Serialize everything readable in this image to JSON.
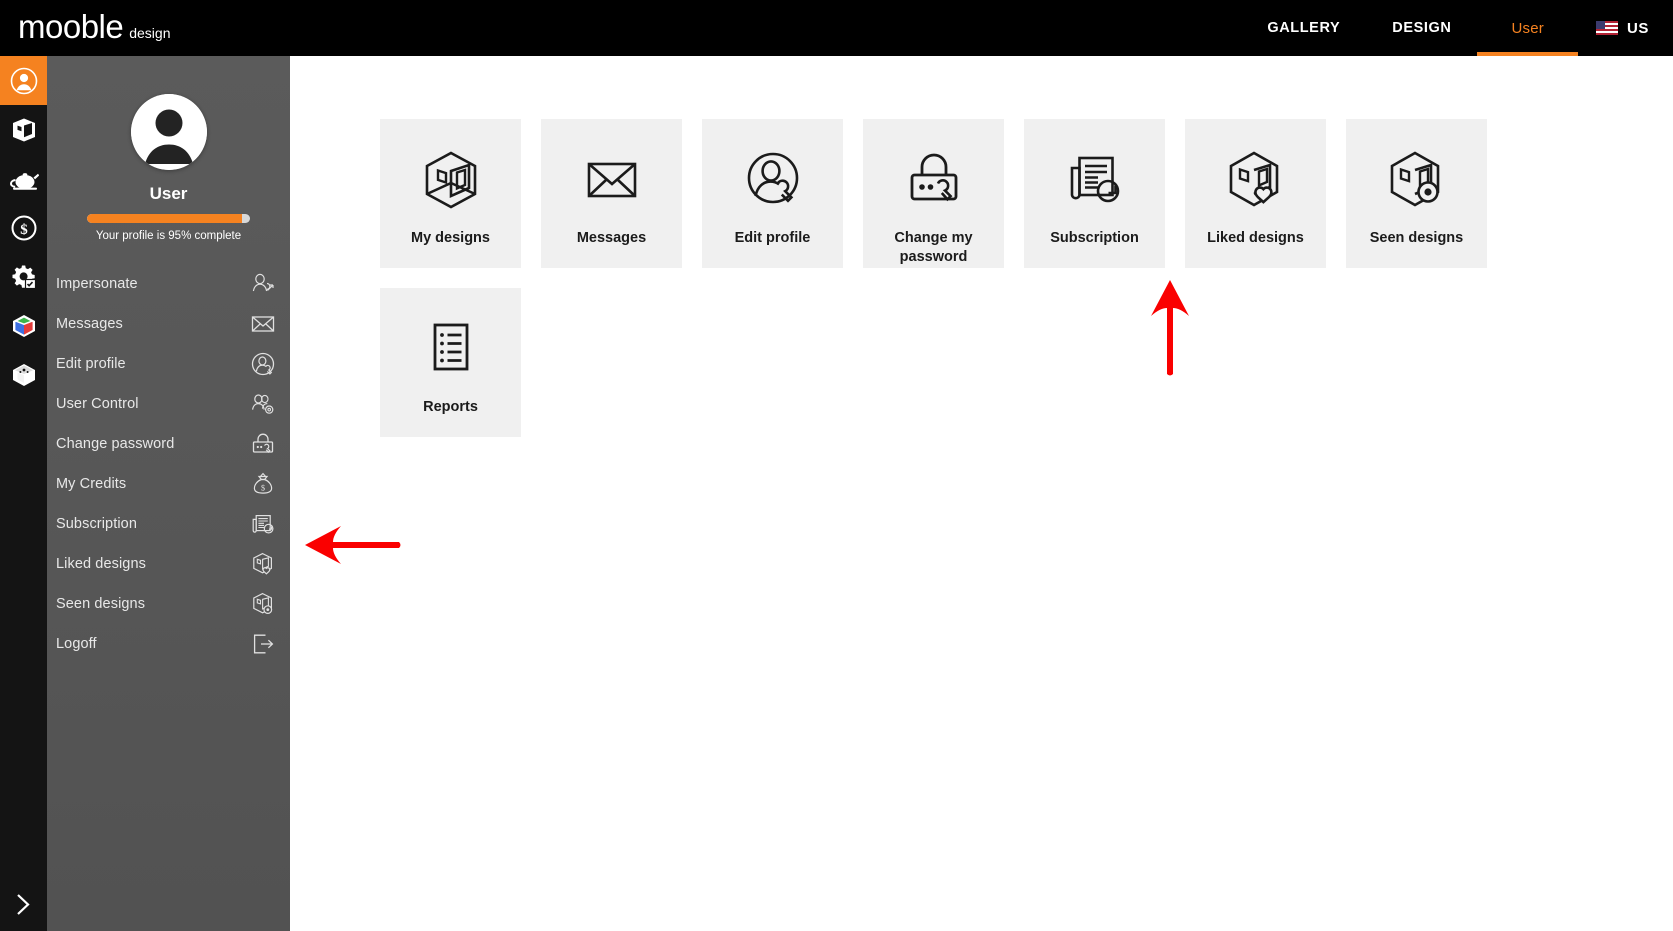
{
  "header": {
    "logo_main": "mooble",
    "logo_sub": "design",
    "nav": [
      {
        "label": "GALLERY",
        "name": "nav-gallery",
        "active": false
      },
      {
        "label": "DESIGN",
        "name": "nav-design",
        "active": false
      },
      {
        "label": "User",
        "name": "nav-user",
        "active": true
      }
    ],
    "language": {
      "label": "US",
      "flag": "us-flag-icon"
    }
  },
  "rail": {
    "items": [
      {
        "icon": "user-circle-icon",
        "name": "rail-item-user",
        "active": true
      },
      {
        "icon": "room-design-icon",
        "name": "rail-item-designs",
        "active": false
      },
      {
        "icon": "teapot-icon",
        "name": "rail-item-products",
        "active": false
      },
      {
        "icon": "dollar-circle-icon",
        "name": "rail-item-credits",
        "active": false
      },
      {
        "icon": "gear-checklist-icon",
        "name": "rail-item-settings",
        "active": false
      },
      {
        "icon": "color-cube-icon",
        "name": "rail-item-materials",
        "active": false
      },
      {
        "icon": "white-cube-icon",
        "name": "rail-item-models",
        "active": false
      }
    ],
    "expand_icon": "chevron-right-icon"
  },
  "sidebar": {
    "avatar_icon": "user-avatar-placeholder",
    "username": "User",
    "profile_progress_percent": 95,
    "profile_progress_label": "Your profile is 95% complete",
    "items": [
      {
        "label": "Impersonate",
        "icon": "impersonate-icon"
      },
      {
        "label": "Messages",
        "icon": "envelope-icon"
      },
      {
        "label": "Edit profile",
        "icon": "edit-profile-icon"
      },
      {
        "label": "User Control",
        "icon": "user-control-icon"
      },
      {
        "label": "Change password",
        "icon": "lock-wrench-icon"
      },
      {
        "label": "My Credits",
        "icon": "money-bag-icon"
      },
      {
        "label": "Subscription",
        "icon": "newspaper-refresh-icon"
      },
      {
        "label": "Liked designs",
        "icon": "room-heart-icon"
      },
      {
        "label": "Seen designs",
        "icon": "room-eye-icon"
      },
      {
        "label": "Logoff",
        "icon": "logout-icon"
      }
    ]
  },
  "main": {
    "tiles": [
      {
        "label": "My designs",
        "icon": "room-design-icon"
      },
      {
        "label": "Messages",
        "icon": "envelope-icon"
      },
      {
        "label": "Edit profile",
        "icon": "edit-profile-icon"
      },
      {
        "label": "Change my password",
        "icon": "lock-wrench-icon"
      },
      {
        "label": "Subscription",
        "icon": "newspaper-refresh-icon"
      },
      {
        "label": "Liked designs",
        "icon": "room-heart-icon"
      },
      {
        "label": "Seen designs",
        "icon": "room-eye-icon"
      },
      {
        "label": "Reports",
        "icon": "report-list-icon"
      }
    ]
  },
  "annotations": [
    {
      "name": "arrow-pointing-to-subscription-tile",
      "direction": "up",
      "color": "#fa0000"
    },
    {
      "name": "arrow-pointing-to-subscription-menu-item",
      "direction": "left",
      "color": "#fa0000"
    }
  ],
  "colors": {
    "accent": "#f58220",
    "topbar_bg": "#000000",
    "rail_bg": "#141414",
    "sidebar_bg": "#575757",
    "tile_bg": "#f0f0f0",
    "annotation_red": "#fa0000"
  }
}
